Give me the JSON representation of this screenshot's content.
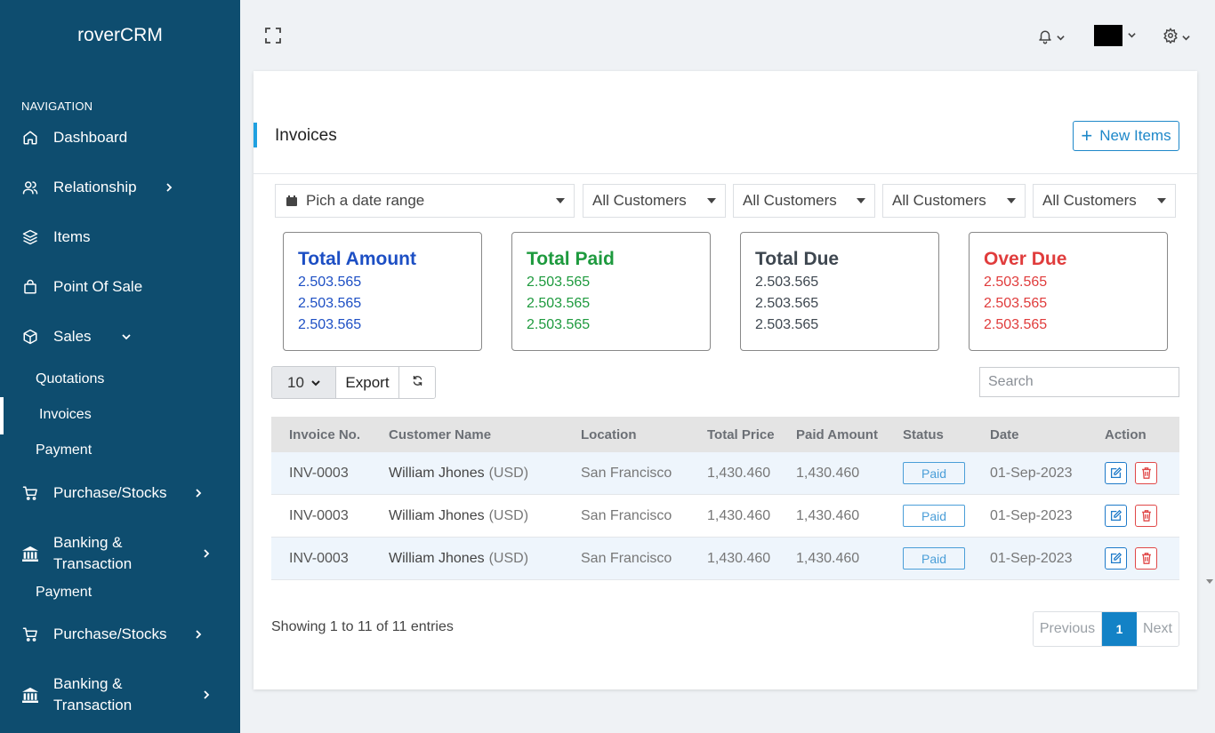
{
  "app": {
    "brand": "roverCRM"
  },
  "sidebar": {
    "heading": "NAVIGATION",
    "items": [
      {
        "label": "Dashboard",
        "icon": "home-icon"
      },
      {
        "label": "Relationship",
        "icon": "users-icon"
      },
      {
        "label": "Items",
        "icon": "layers-icon"
      },
      {
        "label": "Point Of Sale",
        "icon": "shopping-bag-icon"
      },
      {
        "label": "Sales",
        "icon": "box-icon"
      },
      {
        "label": "Purchase/Stocks",
        "icon": "cart-icon"
      },
      {
        "label": "Banking &",
        "label2": "Transaction",
        "icon": "bank-icon"
      },
      {
        "label": "Purchase/Stocks",
        "icon": "cart-icon"
      },
      {
        "label": "Banking &",
        "label2": "Transaction",
        "icon": "bank-icon"
      }
    ],
    "sales_sub": [
      "Quotations",
      "Invoices",
      "Payment"
    ],
    "stray_sub": "Payment"
  },
  "page": {
    "title": "Invoices",
    "new_button": "New Items"
  },
  "filters": {
    "date_range": "Pich a date range",
    "customers": [
      "All Customers",
      "All Customers",
      "All Customers",
      "All Customers"
    ]
  },
  "stats": [
    {
      "title": "Total Amount",
      "values": [
        "2.503.565",
        "2.503.565",
        "2.503.565"
      ],
      "color": "#1d4fc4"
    },
    {
      "title": "Total Paid",
      "values": [
        "2.503.565",
        "2.503.565",
        "2.503.565"
      ],
      "color": "#1e9a3e"
    },
    {
      "title": "Total Due",
      "values": [
        "2.503.565",
        "2.503.565",
        "2.503.565"
      ],
      "color": "#3e4750"
    },
    {
      "title": "Over Due",
      "values": [
        "2.503.565",
        "2.503.565",
        "2.503.565"
      ],
      "color": "#e03c3c"
    }
  ],
  "toolbar": {
    "page_length": "10",
    "export": "Export",
    "search_placeholder": "Search"
  },
  "table": {
    "headers": [
      "Invoice No.",
      "Customer Name",
      "Location",
      "Total Price",
      "Paid Amount",
      "Status",
      "Date",
      "Action"
    ],
    "rows": [
      {
        "invoice": "INV-0003",
        "customer": "William Jhones",
        "currency": "(USD)",
        "location": "San Francisco",
        "total": "1,430.460",
        "paid": "1,430.460",
        "status": "Paid",
        "date": "01-Sep-2023"
      },
      {
        "invoice": "INV-0003",
        "customer": "William Jhones",
        "currency": "(USD)",
        "location": "San Francisco",
        "total": "1,430.460",
        "paid": "1,430.460",
        "status": "Paid",
        "date": "01-Sep-2023"
      },
      {
        "invoice": "INV-0003",
        "customer": "William Jhones",
        "currency": "(USD)",
        "location": "San Francisco",
        "total": "1,430.460",
        "paid": "1,430.460",
        "status": "Paid",
        "date": "01-Sep-2023"
      }
    ]
  },
  "footer": {
    "info": "Showing 1 to 11 of 11 entries",
    "previous": "Previous",
    "current_page": "1",
    "next": "Next"
  }
}
